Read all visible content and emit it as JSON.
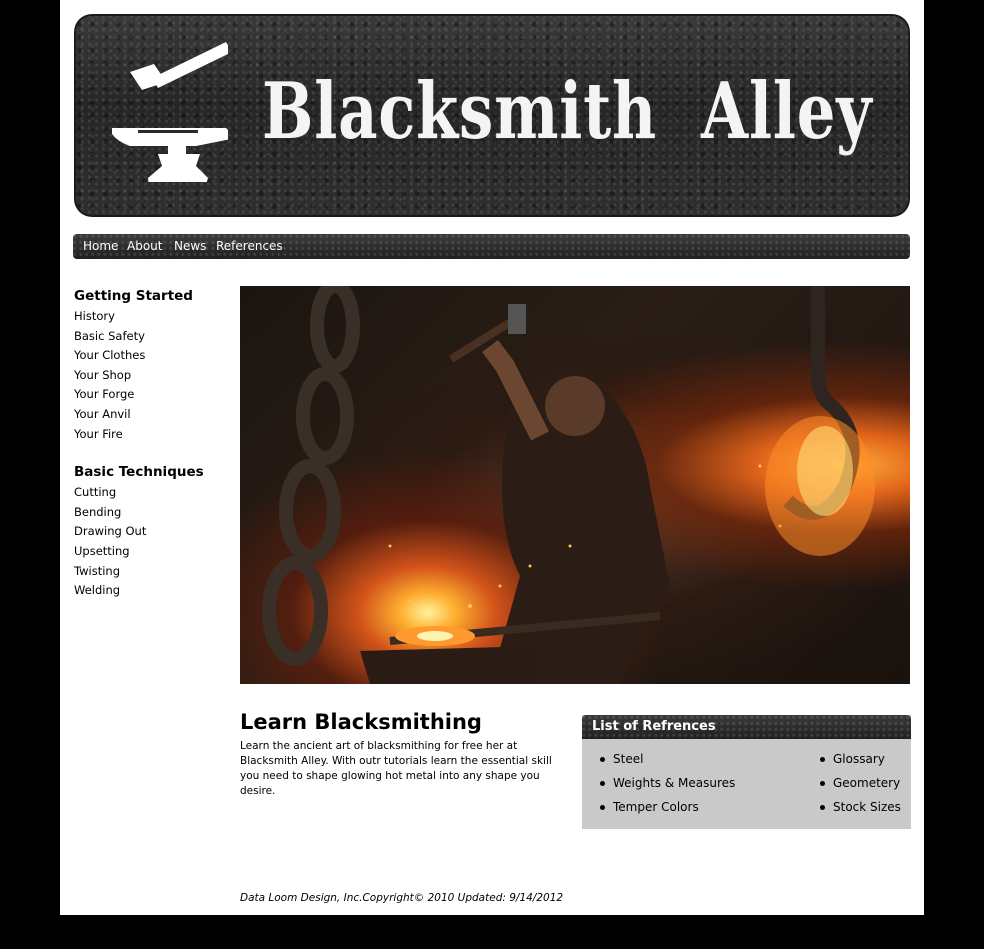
{
  "site": {
    "title": "Blacksmith  Alley",
    "logo_icon": "anvil-hammer-icon"
  },
  "nav": [
    {
      "label": "Home"
    },
    {
      "label": "About"
    },
    {
      "label": "News"
    },
    {
      "label": "References"
    }
  ],
  "sidebar": {
    "groups": [
      {
        "heading": "Getting Started",
        "items": [
          "History",
          "Basic Safety",
          "Your Clothes",
          "Your Shop",
          "Your Forge",
          "Your Anvil",
          "Your Fire"
        ]
      },
      {
        "heading": "Basic Techniques",
        "items": [
          "Cutting",
          "Bending",
          "Drawing Out",
          "Upsetting",
          "Twisting",
          "Welding"
        ]
      }
    ]
  },
  "main": {
    "heading": "Learn Blacksmithing",
    "intro": "Learn the ancient art of blacksmithing for free her at Blacksmith Alley. With outr tutorials learn the essential skill you need to shape glowing hot metal into any shape you desire."
  },
  "references": {
    "title": "List of Refrences",
    "left": [
      "Steel",
      "Weights & Measures",
      "Temper Colors"
    ],
    "right": [
      "Glossary",
      "Geometery",
      "Stock Sizes"
    ]
  },
  "footer": {
    "text": "Data Loom Design, Inc.Copyright© 2010 Updated: 9/14/2012"
  },
  "colors": {
    "background": "#000000",
    "page": "#ffffff",
    "panel": "#c9c9c9",
    "banner": "#2a2a2a"
  }
}
